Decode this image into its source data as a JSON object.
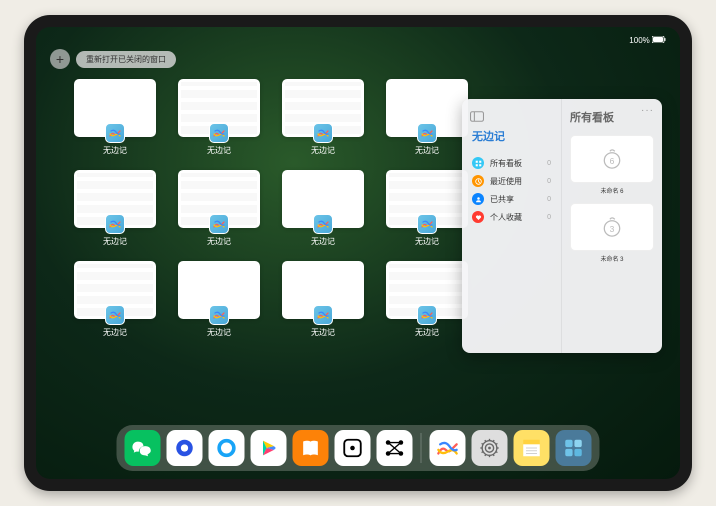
{
  "status": {
    "time": "",
    "battery": "100%"
  },
  "topbar": {
    "plus": "+",
    "reopen_label": "重新打开已关闭的窗口"
  },
  "windows": [
    {
      "label": "无边记",
      "style": "blank"
    },
    {
      "label": "无边记",
      "style": "detailed"
    },
    {
      "label": "无边记",
      "style": "detailed"
    },
    {
      "label": "无边记",
      "style": "blank"
    },
    {
      "label": "无边记",
      "style": "detailed"
    },
    {
      "label": "无边记",
      "style": "detailed"
    },
    {
      "label": "无边记",
      "style": "blank"
    },
    {
      "label": "无边记",
      "style": "detailed"
    },
    {
      "label": "无边记",
      "style": "detailed"
    },
    {
      "label": "无边记",
      "style": "blank"
    },
    {
      "label": "无边记",
      "style": "blank"
    },
    {
      "label": "无边记",
      "style": "detailed"
    }
  ],
  "panel": {
    "left_title": "无边记",
    "nav": [
      {
        "icon": "c1",
        "label": "所有看板",
        "count": "0"
      },
      {
        "icon": "c2",
        "label": "最近使用",
        "count": "0"
      },
      {
        "icon": "c3",
        "label": "已共享",
        "count": "0"
      },
      {
        "icon": "c4",
        "label": "个人收藏",
        "count": "0"
      }
    ],
    "right_title": "所有看板",
    "boards": [
      {
        "label": "未命名 6",
        "date": "",
        "glyph": "6"
      },
      {
        "label": "未命名 3",
        "date": "",
        "glyph": "3"
      }
    ]
  },
  "dock": [
    {
      "name": "wechat",
      "bg": "#07c160"
    },
    {
      "name": "quark",
      "bg": "#ffffff"
    },
    {
      "name": "qqbrowser",
      "bg": "#ffffff"
    },
    {
      "name": "play",
      "bg": "#ffffff"
    },
    {
      "name": "books",
      "bg": "#fd8208"
    },
    {
      "name": "dice",
      "bg": "#ffffff"
    },
    {
      "name": "graph",
      "bg": "#ffffff"
    },
    {
      "name": "freeform",
      "bg": "#ffffff"
    },
    {
      "name": "settings",
      "bg": "#dedede"
    },
    {
      "name": "notes",
      "bg": "#ffe066"
    },
    {
      "name": "apps-folder",
      "bg": "#4a7a9a"
    }
  ]
}
